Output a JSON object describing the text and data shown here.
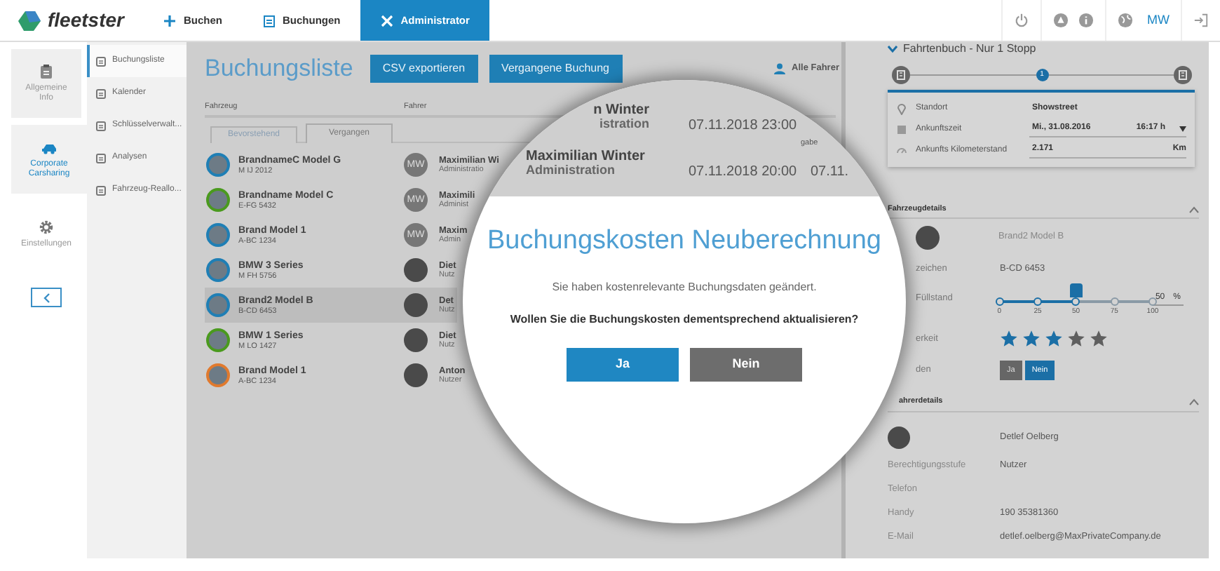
{
  "navbar": {
    "logo": "fleetster",
    "items": [
      {
        "label": "Buchen",
        "selected": false
      },
      {
        "label": "Buchungen",
        "selected": false
      },
      {
        "label": "Administrator",
        "selected": true
      }
    ],
    "user_initials": "MW"
  },
  "modules": [
    {
      "label": "Allgemeine Info",
      "selected": false
    },
    {
      "label": "Corporate Carsharing",
      "selected": true
    },
    {
      "label": "Einstellungen",
      "selected": false
    }
  ],
  "submenu": [
    {
      "label": "Buchungsliste",
      "selected": true
    },
    {
      "label": "Kalender",
      "selected": false
    },
    {
      "label": "Schlüsselverwalt...",
      "selected": false
    },
    {
      "label": "Analysen",
      "selected": false
    },
    {
      "label": "Fahrzeug-Reallo...",
      "selected": false
    }
  ],
  "booking_list": {
    "title": "Buchungsliste",
    "buttons": [
      "CSV exportieren",
      "Vergangene Buchung"
    ],
    "driver_filter": "Alle Fahrer",
    "columns": [
      "Fahrzeug",
      "Fahrer"
    ],
    "tabs": [
      {
        "label": "Bevorstehend",
        "selected": false
      },
      {
        "label": "Vergangen",
        "selected": true
      }
    ],
    "rows": [
      {
        "vehicle": "BrandnameC Model G",
        "plate": "M IJ 2012",
        "color": "#1f7fb5",
        "driver_initials": "MW",
        "driver": "Maximilian Wi",
        "role": "Administratio",
        "selected": false
      },
      {
        "vehicle": "Brandname Model C",
        "plate": "E-FG 5432",
        "color": "#4a9a1e",
        "driver_initials": "MW",
        "driver": "Maximili",
        "role": "Administ",
        "selected": false
      },
      {
        "vehicle": "Brand Model 1",
        "plate": "A-BC 1234",
        "color": "#1f7fb5",
        "driver_initials": "MW",
        "driver": "Maxim",
        "role": "Admin",
        "selected": false
      },
      {
        "vehicle": "BMW 3 Series",
        "plate": "M FH 5756",
        "color": "#1f7fb5",
        "driver": "Diet",
        "role": "Nutz",
        "selected": false
      },
      {
        "vehicle": "Brand2 Model B",
        "plate": "B-CD 6453",
        "color": "#1f7fb5",
        "driver": "Det",
        "role": "Nutz",
        "selected": true
      },
      {
        "vehicle": "BMW 1 Series",
        "plate": "M LO 1427",
        "color": "#4a9a1e",
        "driver": "Diet",
        "role": "Nutz",
        "selected": false
      },
      {
        "vehicle": "Brand Model 1",
        "plate": "A-BC 1234",
        "color": "#e07a2e",
        "driver": "Anton",
        "role": "Nutzer",
        "selected": false
      }
    ]
  },
  "magnifier": {
    "rows": [
      {
        "driver": "n Winter",
        "role": "istration",
        "start": "07.11.2018 23:00",
        "column_4": "gabe"
      },
      {
        "driver": "Maximilian Winter",
        "role": "Administration",
        "start": "07.11.2018 20:00",
        "column_4": "07.11."
      }
    ]
  },
  "dialog": {
    "title": "Buchungskosten Neuberechnung",
    "message": "Sie haben kostenrelevante Buchungsdaten geändert.",
    "question": "Wollen Sie die Buchungskosten dementsprechend aktualisieren?",
    "buttons": [
      {
        "label": "Ja",
        "kind": "primary"
      },
      {
        "label": "Nein",
        "kind": "secondary"
      }
    ]
  },
  "trip_log": {
    "title": "Fahrtenbuch - Nur 1 Stopp",
    "stop_number": "1",
    "fields": [
      {
        "label": "Standort",
        "value": "Showstreet"
      },
      {
        "label": "Ankunftszeit",
        "value": "Mi., 31.08.2016",
        "time": "16:17 h"
      },
      {
        "label": "Ankunfts Kilometerstand",
        "value": "2.171",
        "unit": "Km"
      }
    ]
  },
  "vehicle_details": {
    "title": "Fahrzeugdetails",
    "expanded": true,
    "name": "Brand2 Model B",
    "plate_label": "zeichen",
    "plate": "B-CD 6453",
    "fuel_label": "Füllstand",
    "fuel": {
      "level": 0.5,
      "ticks": [
        "0",
        "25",
        "50",
        "75",
        "100"
      ],
      "value": "50",
      "unit": "%"
    },
    "rating_label": "erkeit",
    "stars": 3,
    "load_label": "den",
    "load": [
      {
        "label": "Ja",
        "selected": false
      },
      {
        "label": "Nein",
        "selected": true
      }
    ]
  },
  "driver_details": {
    "title": "ahrerdetails",
    "expanded": true,
    "name": "Detlef Oelberg",
    "fields": [
      {
        "label": "Berechtigungsstufe",
        "value": "Nutzer"
      },
      {
        "label": "Telefon"
      },
      {
        "label": "Handy",
        "value": "190 35381360"
      },
      {
        "label": "E-Mail",
        "value": "detlef.oelberg@MaxPrivateCompany.de"
      }
    ]
  }
}
